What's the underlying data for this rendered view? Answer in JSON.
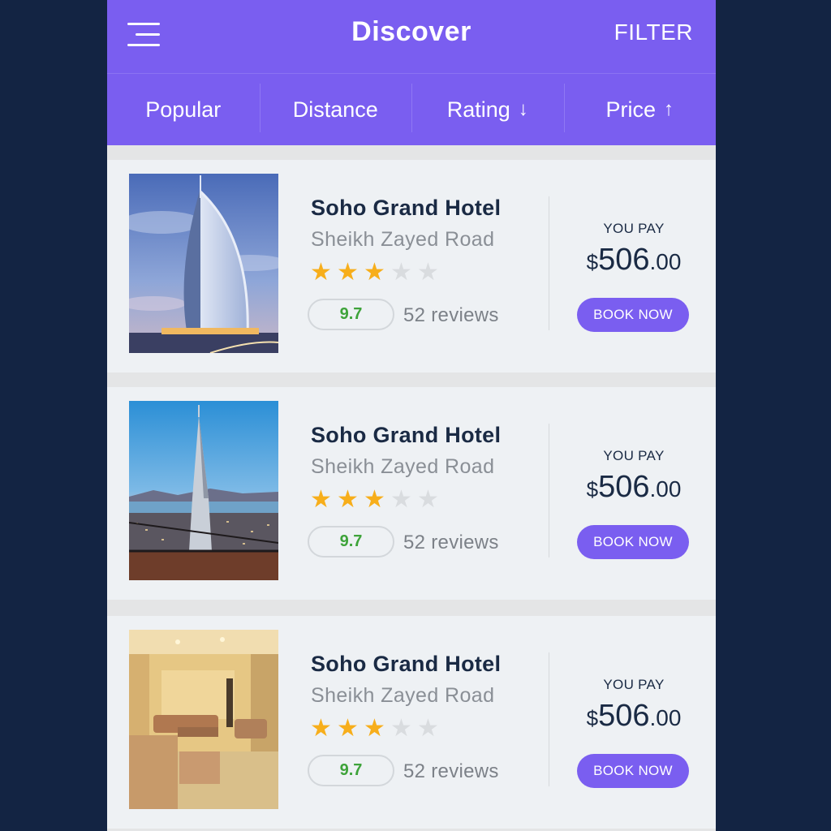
{
  "header": {
    "title": "Discover",
    "filter_label": "FILTER",
    "menu_icon": "hamburger-menu-icon"
  },
  "sort_tabs": [
    {
      "label": "Popular",
      "arrow": ""
    },
    {
      "label": "Distance",
      "arrow": ""
    },
    {
      "label": "Rating",
      "arrow": "↓"
    },
    {
      "label": "Price",
      "arrow": "↑"
    }
  ],
  "colors": {
    "accent": "#7a5ef0",
    "background": "#132443",
    "star_on": "#f7ae1b",
    "star_off": "#d9dcdf",
    "score": "#3ea33a"
  },
  "hotels": [
    {
      "name": "Soho Grand Hotel",
      "address": "Sheikh Zayed Road",
      "stars": 3,
      "max_stars": 5,
      "score": "9.7",
      "reviews": "52 reviews",
      "pay_label": "YOU PAY",
      "currency": "$",
      "price_whole": "506",
      "price_cents": ".00",
      "book_label": "BOOK NOW",
      "image": "sail-tower-hotel-photo"
    },
    {
      "name": "Soho Grand Hotel",
      "address": "Sheikh Zayed Road",
      "stars": 3,
      "max_stars": 5,
      "score": "9.7",
      "reviews": "52 reviews",
      "pay_label": "YOU PAY",
      "currency": "$",
      "price_whole": "506",
      "price_cents": ".00",
      "book_label": "BOOK NOW",
      "image": "pyramid-tower-city-photo"
    },
    {
      "name": "Soho Grand Hotel",
      "address": "Sheikh Zayed Road",
      "stars": 3,
      "max_stars": 5,
      "score": "9.7",
      "reviews": "52 reviews",
      "pay_label": "YOU PAY",
      "currency": "$",
      "price_whole": "506",
      "price_cents": ".00",
      "book_label": "BOOK NOW",
      "image": "hotel-room-interior-photo"
    }
  ]
}
